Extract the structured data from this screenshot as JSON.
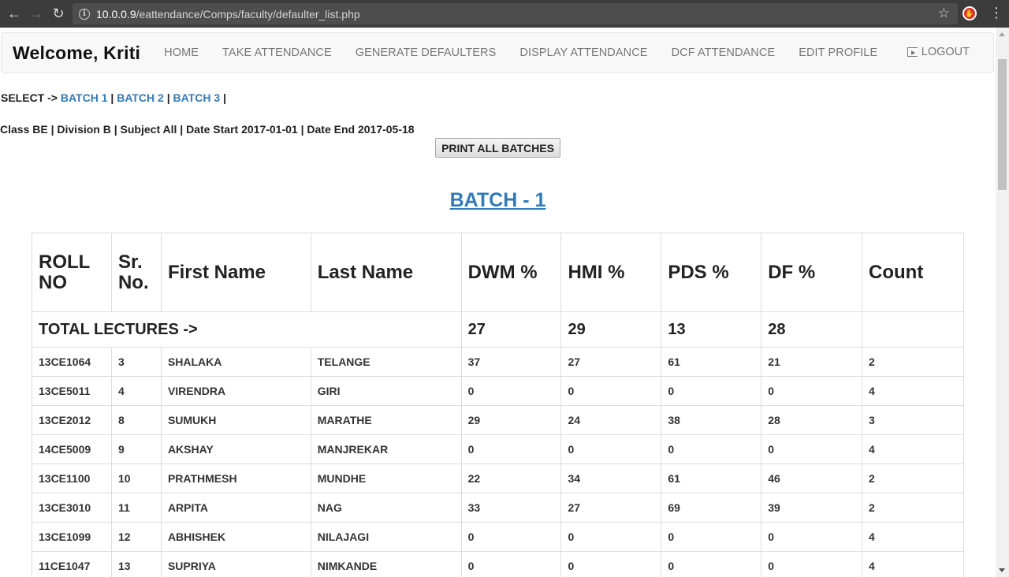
{
  "browser": {
    "url_host": "10.0.0.9",
    "url_path": "/eattendance/Comps/faculty/defaulter_list.php"
  },
  "navbar": {
    "brand": "Welcome, Kriti",
    "links": [
      "HOME",
      "TAKE ATTENDANCE",
      "GENERATE DEFAULTERS",
      "DISPLAY ATTENDANCE",
      "DCF ATTENDANCE",
      "EDIT PROFILE"
    ],
    "logout": "LOGOUT"
  },
  "select": {
    "prefix": "SELECT ->",
    "batches": [
      "BATCH 1",
      "BATCH 2",
      "BATCH 3"
    ],
    "sep": "|"
  },
  "info_line": "Class BE | Division B | Subject All | Date Start 2017-01-01 | Date End 2017-05-18",
  "print_button": "PRINT ALL BATCHES",
  "batch_title": "BATCH - 1",
  "table": {
    "headers": [
      "ROLL NO",
      "Sr. No.",
      "First Name",
      "Last Name",
      "DWM %",
      "HMI %",
      "PDS %",
      "DF %",
      "Count"
    ],
    "total_label": "TOTAL LECTURES ->",
    "totals": [
      "27",
      "29",
      "13",
      "28",
      ""
    ],
    "rows": [
      [
        "13CE1064",
        "3",
        "SHALAKA",
        "TELANGE",
        "37",
        "27",
        "61",
        "21",
        "2"
      ],
      [
        "13CE5011",
        "4",
        "VIRENDRA",
        "GIRI",
        "0",
        "0",
        "0",
        "0",
        "4"
      ],
      [
        "13CE2012",
        "8",
        "SUMUKH",
        "MARATHE",
        "29",
        "24",
        "38",
        "28",
        "3"
      ],
      [
        "14CE5009",
        "9",
        "AKSHAY",
        "MANJREKAR",
        "0",
        "0",
        "0",
        "0",
        "4"
      ],
      [
        "13CE1100",
        "10",
        "PRATHMESH",
        "MUNDHE",
        "22",
        "34",
        "61",
        "46",
        "2"
      ],
      [
        "13CE3010",
        "11",
        "ARPITA",
        "NAG",
        "33",
        "27",
        "69",
        "39",
        "2"
      ],
      [
        "13CE1099",
        "12",
        "ABHISHEK",
        "NILAJAGI",
        "0",
        "0",
        "0",
        "0",
        "4"
      ],
      [
        "11CE1047",
        "13",
        "SUPRIYA",
        "NIMKANDE",
        "0",
        "0",
        "0",
        "0",
        "4"
      ]
    ]
  }
}
